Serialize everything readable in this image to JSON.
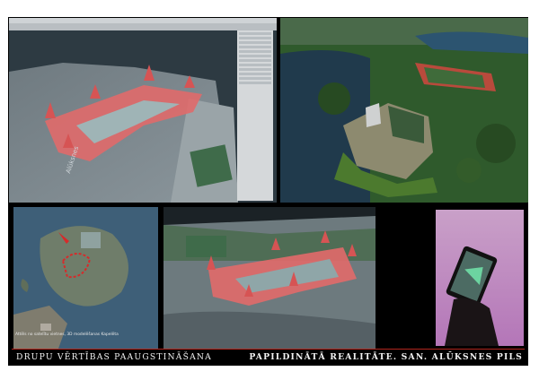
{
  "editor": {
    "overlay_text": "Alūksnes"
  },
  "map": {
    "source_note": "Attēls no satelītu vietnes, 3D modelēšanas Kapelēta"
  },
  "captions": {
    "left": "DRUPU VĒRTĪBAS PAAUGSTINĀŠANA",
    "right": "PAPILDINĀTĀ REALITĀTE. SAN. ALŪKSNES PILS"
  },
  "colors": {
    "accent_red": "#b3261e",
    "castle_overlay": "#e06a6a",
    "background": "#000000"
  },
  "icons": {
    "castle_model": "castle-model-icon",
    "phone": "phone-icon",
    "map_marker": "map-marker-icon"
  }
}
